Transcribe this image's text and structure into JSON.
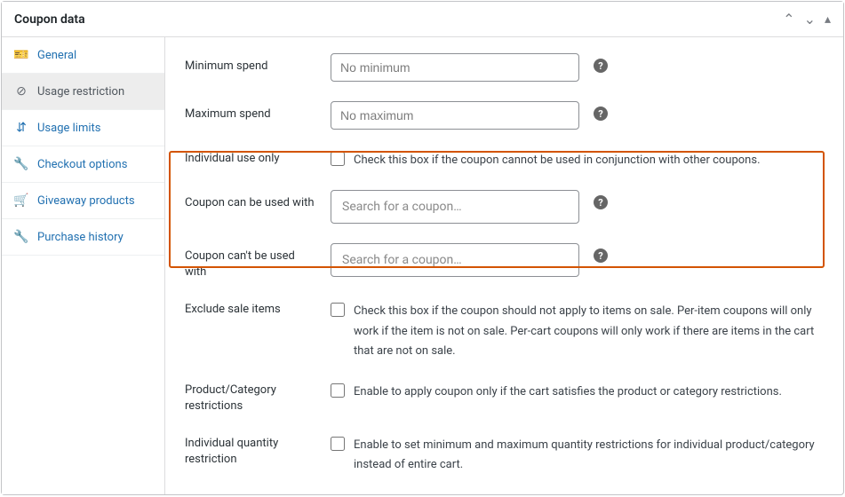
{
  "panel": {
    "title": "Coupon data"
  },
  "sidebar": {
    "items": [
      {
        "icon": "🎫",
        "label": "General"
      },
      {
        "icon": "⊘",
        "label": "Usage restriction"
      },
      {
        "icon": "⇵",
        "label": "Usage limits"
      },
      {
        "icon": "🔧",
        "label": "Checkout options"
      },
      {
        "icon": "🛒",
        "label": "Giveaway products"
      },
      {
        "icon": "🔧",
        "label": "Purchase history"
      }
    ]
  },
  "fields": {
    "min_spend": {
      "label": "Minimum spend",
      "placeholder": "No minimum"
    },
    "max_spend": {
      "label": "Maximum spend",
      "placeholder": "No maximum"
    },
    "individual_use": {
      "label": "Individual use only",
      "desc": "Check this box if the coupon cannot be used in conjunction with other coupons."
    },
    "can_use_with": {
      "label": "Coupon can be used with",
      "placeholder": "Search for a coupon…"
    },
    "cant_use_with": {
      "label": "Coupon can't be used with",
      "placeholder": "Search for a coupon…"
    },
    "exclude_sale": {
      "label": "Exclude sale items",
      "desc": "Check this box if the coupon should not apply to items on sale. Per-item coupons will only work if the item is not on sale. Per-cart coupons will only work if there are items in the cart that are not on sale."
    },
    "prod_cat": {
      "label": "Product/Category restrictions",
      "desc": "Enable to apply coupon only if the cart satisfies the product or category restrictions."
    },
    "ind_qty": {
      "label": "Individual quantity restriction",
      "desc": "Enable to set minimum and maximum quantity restrictions for individual product/category instead of entire cart."
    }
  }
}
